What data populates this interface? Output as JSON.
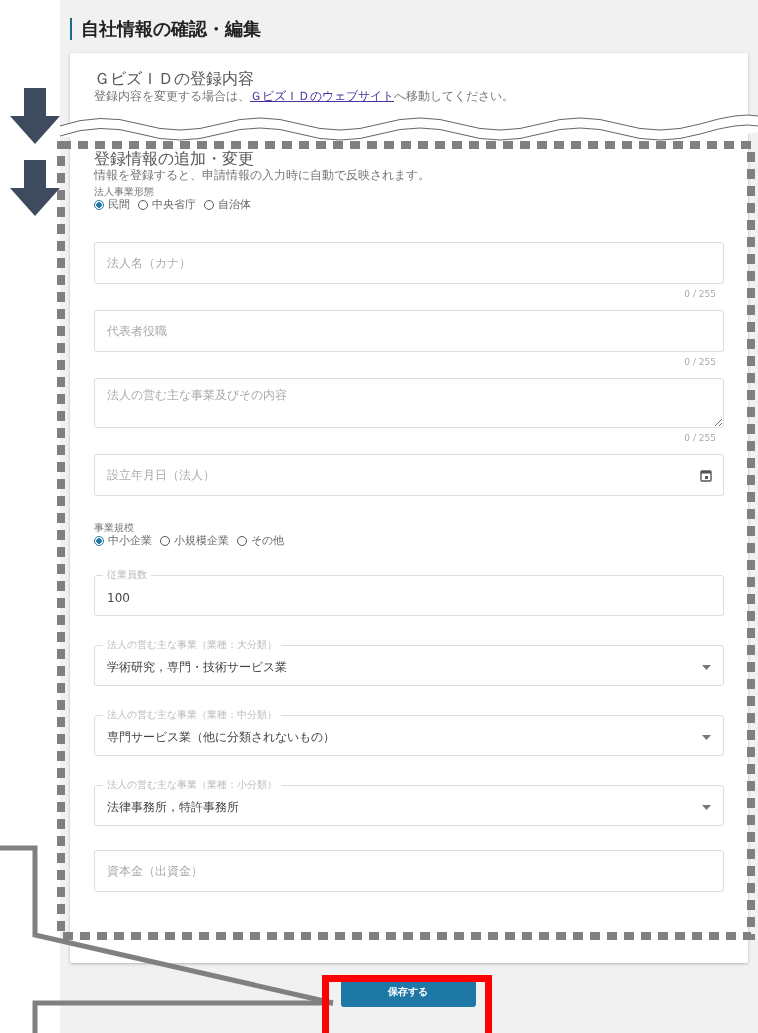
{
  "page_title": "自社情報の確認・編集",
  "gbiz_section": {
    "title": "ＧビズＩＤの登録内容",
    "note_before": "登録内容を変更する場合は、",
    "link": "ＧビズＩＤのウェブサイト",
    "note_after": "へ移動してください。"
  },
  "form_section": {
    "title": "登録情報の追加・変更",
    "note": "情報を登録すると、申請情報の入力時に自動で反映されます。",
    "fields": [
      {
        "kind": "radio",
        "label": "法人事業形態",
        "options": [
          {
            "label": "民間",
            "selected": true
          },
          {
            "label": "中央省庁",
            "selected": false
          },
          {
            "label": "自治体",
            "selected": false
          }
        ]
      },
      {
        "kind": "text",
        "placeholder": "法人名（カナ）",
        "counter": "0 / 255"
      },
      {
        "kind": "text",
        "placeholder": "代表者役職",
        "counter": "0 / 255"
      },
      {
        "kind": "textarea",
        "placeholder": "法人の営む主な事業及びその内容",
        "counter": "0 / 255"
      },
      {
        "kind": "date",
        "placeholder": "設立年月日（法人）"
      },
      {
        "kind": "radio",
        "label": "事業規模",
        "options": [
          {
            "label": "中小企業",
            "selected": true
          },
          {
            "label": "小規模企業",
            "selected": false
          },
          {
            "label": "その他",
            "selected": false
          }
        ]
      },
      {
        "kind": "number",
        "label": "従業員数",
        "value": "100"
      },
      {
        "kind": "select",
        "label": "法人の営む主な事業（業種：大分類）",
        "value": "学術研究，専門・技術サービス業"
      },
      {
        "kind": "select",
        "label": "法人の営む主な事業（業種：中分類）",
        "value": "専門サービス業（他に分類されないもの）"
      },
      {
        "kind": "select",
        "label": "法人の営む主な事業（業種：小分類）",
        "value": "法律事務所，特許事務所"
      },
      {
        "kind": "text",
        "placeholder": "資本金（出資金）"
      }
    ]
  },
  "save_button": "保存する"
}
